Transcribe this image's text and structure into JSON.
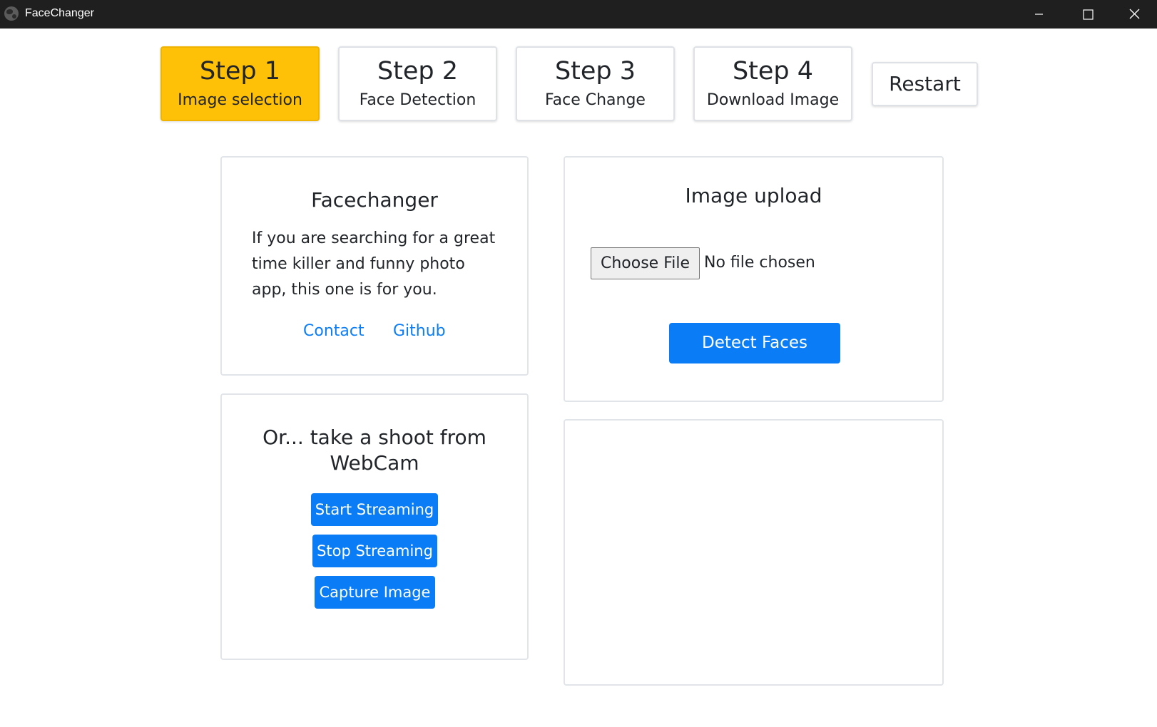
{
  "window": {
    "title": "FaceChanger",
    "icon": "globe-icon",
    "controls": [
      "minimize-icon",
      "maximize-icon",
      "close-icon"
    ]
  },
  "steps": [
    {
      "title": "Step 1",
      "subtitle": "Image selection",
      "active": true
    },
    {
      "title": "Step 2",
      "subtitle": "Face Detection",
      "active": false
    },
    {
      "title": "Step 3",
      "subtitle": "Face Change",
      "active": false
    },
    {
      "title": "Step 4",
      "subtitle": "Download Image",
      "active": false
    }
  ],
  "restart_label": "Restart",
  "about": {
    "title": "Facechanger",
    "text": "If you are searching for a great time killer and funny photo app, this one is for you.",
    "links": {
      "contact": "Contact",
      "github": "Github"
    }
  },
  "webcam": {
    "title": "Or... take a shoot from WebCam",
    "start_label": "Start Streaming",
    "stop_label": "Stop Streaming",
    "capture_label": "Capture Image"
  },
  "upload": {
    "title": "Image upload",
    "choose_label": "Choose File",
    "file_status": "No file chosen",
    "detect_label": "Detect Faces"
  },
  "colors": {
    "titlebar": "#1f1f1f",
    "active_step": "#ffc107",
    "primary_button": "#0a7cf5",
    "link": "#0d7ef5"
  }
}
